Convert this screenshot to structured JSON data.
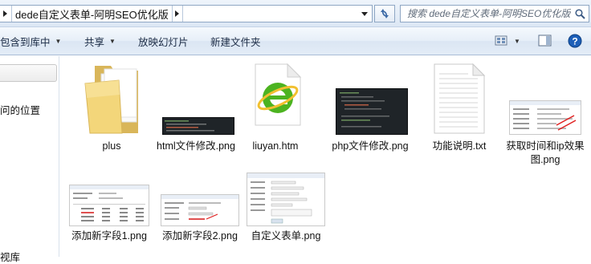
{
  "address_bar": {
    "path_segment": "dede自定义表单-阿明SEO优化版"
  },
  "search": {
    "placeholder": "搜索 dede自定义表单-阿明SEO优化版"
  },
  "toolbar": {
    "include_library": "包含到库中",
    "share": "共享",
    "slideshow": "放映幻灯片",
    "new_folder": "新建文件夹"
  },
  "nav": {
    "recent_places": "问的位置",
    "bottom_item": "视库"
  },
  "files": [
    {
      "name": "plus",
      "type": "folder"
    },
    {
      "name": "html文件修改.png",
      "type": "image-dark"
    },
    {
      "name": "liuyan.htm",
      "type": "html"
    },
    {
      "name": "php文件修改.png",
      "type": "image-dark"
    },
    {
      "name": "功能说明.txt",
      "type": "text"
    },
    {
      "name": "获取时间和ip效果图.png",
      "type": "image-light"
    },
    {
      "name": "添加新字段1.png",
      "type": "image-light"
    },
    {
      "name": "添加新字段2.png",
      "type": "image-light"
    },
    {
      "name": "自定义表单.png",
      "type": "image-light"
    }
  ],
  "colors": {
    "toolbar_text": "#1b2b45",
    "ie_green": "#4cb320",
    "folder_yellow": "#f3d67a",
    "help_blue": "#1d5fb8"
  }
}
